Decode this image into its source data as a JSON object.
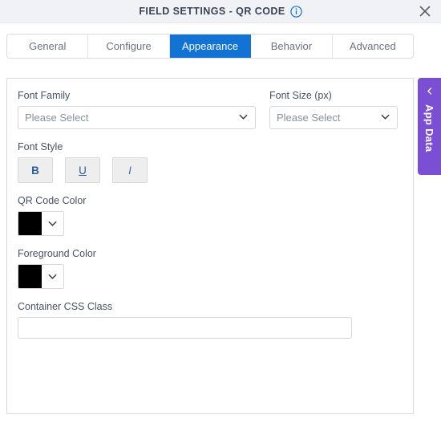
{
  "header": {
    "title": "FIELD SETTINGS - QR CODE",
    "info_icon": "info-circle-icon",
    "close_icon": "close-icon"
  },
  "tabs": [
    {
      "label": "General",
      "active": false
    },
    {
      "label": "Configure",
      "active": false
    },
    {
      "label": "Appearance",
      "active": true
    },
    {
      "label": "Behavior",
      "active": false
    },
    {
      "label": "Advanced",
      "active": false
    }
  ],
  "form": {
    "font_family": {
      "label": "Font Family",
      "value": "Please Select",
      "chevron_icon": "chevron-down-icon"
    },
    "font_size": {
      "label": "Font Size (px)",
      "value": "Please Select",
      "chevron_icon": "chevron-down-icon"
    },
    "font_style": {
      "label": "Font Style",
      "buttons": [
        {
          "label": "B",
          "name": "bold-button"
        },
        {
          "label": "U",
          "name": "underline-button"
        },
        {
          "label": "I",
          "name": "italic-button"
        }
      ]
    },
    "qr_code_color": {
      "label": "QR Code Color",
      "value": "#000000",
      "chevron_icon": "chevron-down-icon"
    },
    "foreground_color": {
      "label": "Foreground Color",
      "value": "#000000",
      "chevron_icon": "chevron-down-icon"
    },
    "container_css_class": {
      "label": "Container CSS Class",
      "value": "",
      "placeholder": ""
    }
  },
  "app_data_tab": {
    "label": "App Data",
    "chevron_icon": "chevron-left-icon",
    "color": "#7b4fd4"
  },
  "colors": {
    "accent": "#1273d4",
    "info": "#1273d4",
    "purple": "#7b4fd4"
  }
}
